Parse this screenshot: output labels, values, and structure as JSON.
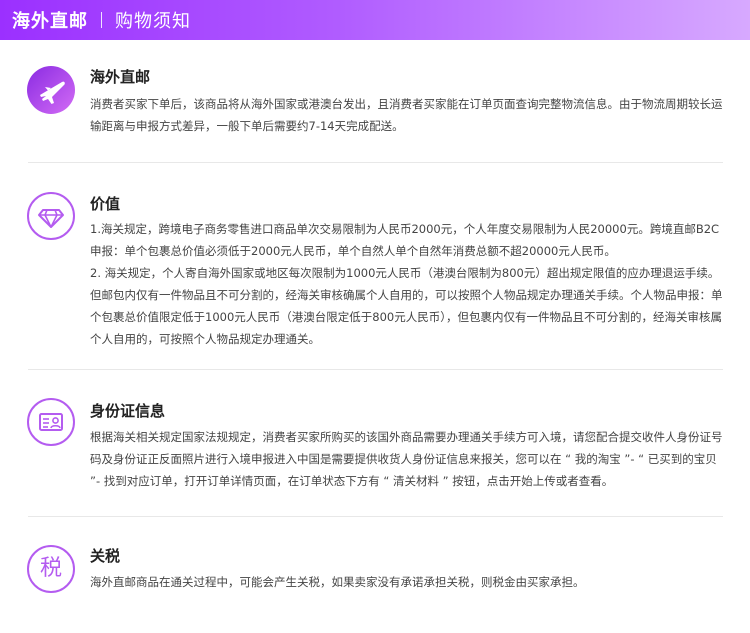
{
  "header": {
    "title": "海外直邮",
    "subtitle": "购物须知"
  },
  "sections": [
    {
      "icon": "airplane-icon",
      "title": "海外直邮",
      "paragraphs": [
        "消费者买家下单后，该商品将从海外国家或港澳台发出，且消费者买家能在订单页面查询完整物流信息。由于物流周期较长运输距离与申报方式差异，一般下单后需要约7-14天完成配送。"
      ]
    },
    {
      "icon": "diamond-icon",
      "title": "价值",
      "paragraphs": [
        "1.海关规定，跨境电子商务零售进口商品单次交易限制为人民币2000元，个人年度交易限制为人民20000元。跨境直邮B2C申报：单个包裹总价值必须低于2000元人民币，单个自然人单个自然年消费总额不超20000元人民币。",
        "2. 海关规定，个人寄自海外国家或地区每次限制为1000元人民币（港澳台限制为800元）超出规定限值的应办理退运手续。但邮包内仅有一件物品且不可分割的，经海关审核确属个人自用的，可以按照个人物品规定办理通关手续。个人物品申报：单个包裹总价值限定低于1000元人民币（港澳台限定低于800元人民币），但包裹内仅有一件物品且不可分割的，经海关审核属个人自用的，可按照个人物品规定办理通关。"
      ]
    },
    {
      "icon": "id-card-icon",
      "title": "身份证信息",
      "paragraphs": [
        "根据海关相关规定国家法规规定，消费者买家所购买的该国外商品需要办理通关手续方可入境，请您配合提交收件人身份证号码及身份证正反面照片进行入境申报进入中国是需要提供收货人身份证信息来报关，您可以在 “ 我的淘宝 ”- “ 已买到的宝贝 ”- 找到对应订单，打开订单详情页面，在订单状态下方有 “ 清关材料 ” 按钮，点击开始上传或者查看。"
      ]
    },
    {
      "icon": "tax-icon",
      "icon_text": "税",
      "title": "关税",
      "paragraphs": [
        "海外直邮商品在通关过程中，可能会产生关税，如果卖家没有承诺承担关税，则税金由买家承担。"
      ]
    }
  ]
}
